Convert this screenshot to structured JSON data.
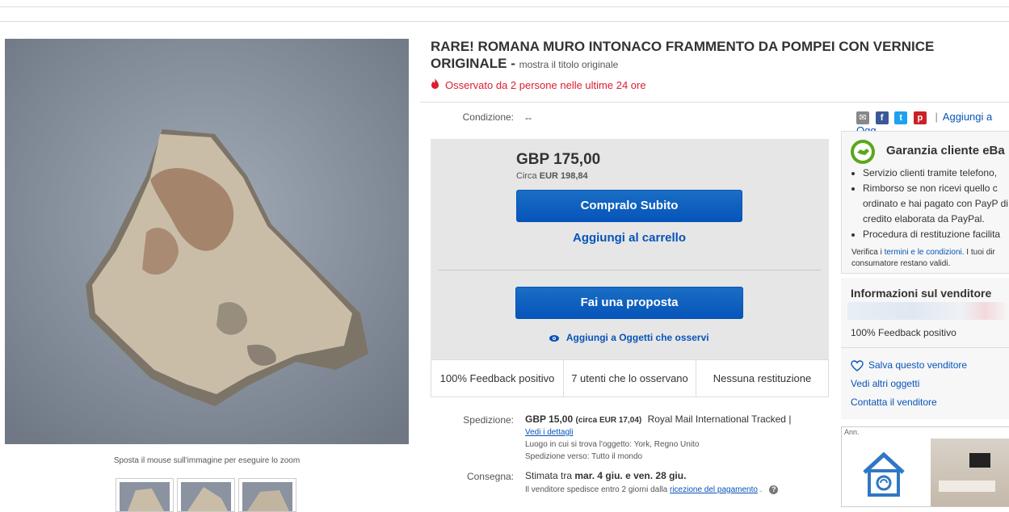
{
  "title": {
    "main": "RARE! ROMANA MURO INTONACO FRAMMENTO DA POMPEI CON VERNICE ORIGINALE",
    "separator": "-",
    "show_original": "mostra il titolo originale"
  },
  "watchers_banner": "Osservato da 2 persone nelle ultime 24 ore",
  "condition": {
    "label": "Condizione:",
    "value": "--"
  },
  "price": {
    "main": "GBP 175,00",
    "approx_prefix": "Circa",
    "approx_value": "EUR 198,84"
  },
  "buttons": {
    "buy_now": "Compralo Subito",
    "add_cart": "Aggiungi al carrello",
    "make_offer": "Fai una proposta",
    "add_watch": "Aggiungi a Oggetti che osservi"
  },
  "stats": [
    "100% Feedback positivo",
    "7 utenti che lo osservano",
    "Nessuna restituzione"
  ],
  "shipping": {
    "label": "Spedizione:",
    "price": "GBP 15,00",
    "approx": "(circa EUR 17,04)",
    "service": "Royal Mail International Tracked |",
    "details_link": "Vedi i dettagli",
    "location": "Luogo in cui si trova l'oggetto: York, Regno Unito",
    "ships_to": "Spedizione verso: Tutto il mondo"
  },
  "delivery": {
    "label": "Consegna:",
    "estimate_prefix": "Stimata tra",
    "estimate_range": "mar. 4 giu. e ven. 28 giu.",
    "note_prefix": "Il venditore spedisce entro 2 giorni dalla",
    "note_link": "ricezione del pagamento",
    "note_suffix": "."
  },
  "image": {
    "zoom_hint": "Sposta il mouse sull'immagine per eseguire lo zoom"
  },
  "share": {
    "add_link": "Aggiungi a Ogg",
    "separator": "|"
  },
  "guarantee": {
    "title": "Garanzia cliente eBa",
    "items": [
      "Servizio clienti tramite telefono,",
      "Rimborso se non ricevi quello c ordinato e hai pagato con PayP di credito elaborata da PayPal.",
      "Procedura di restituzione facilita"
    ],
    "footer_prefix": "Verifica i",
    "footer_link": "termini e le condizioni",
    "footer_suffix": ". I tuoi dir consumatore restano validi."
  },
  "seller": {
    "title": "Informazioni sul venditore",
    "feedback": "100% Feedback positivo",
    "save": "Salva questo venditore",
    "other_items": "Vedi altri oggetti",
    "contact": "Contatta il venditore"
  },
  "ad": {
    "label": "Ann."
  },
  "colors": {
    "link": "#0654ba",
    "alert": "#dd1e31",
    "button": "#0654ba"
  }
}
